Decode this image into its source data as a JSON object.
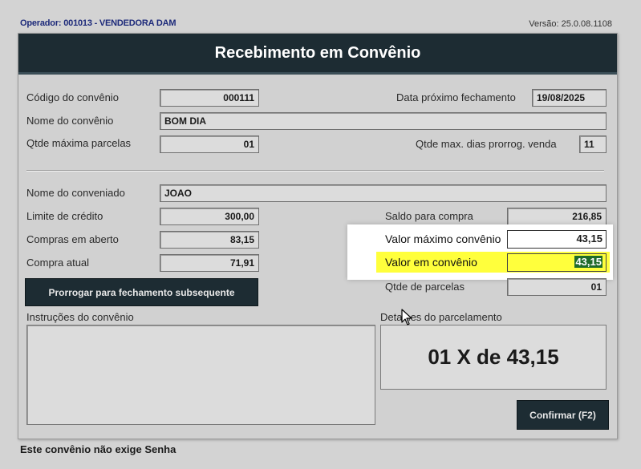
{
  "header": {
    "operator": "Operador: 001013 - VENDEDORA DAM",
    "version": "Versão: 25.0.08.1108"
  },
  "window": {
    "title": "Recebimento em Convênio"
  },
  "convenio": {
    "codigo_label": "Código do convênio",
    "codigo_value": "000111",
    "data_fechamento_label": "Data próximo fechamento",
    "data_fechamento_value": "19/08/2025",
    "nome_label": "Nome do convênio",
    "nome_value": "BOM DIA",
    "qtde_parcelas_label": "Qtde máxima parcelas",
    "qtde_parcelas_value": "01",
    "qtde_dias_label": "Qtde max. dias prorrog. venda",
    "qtde_dias_value": "11"
  },
  "conveniado": {
    "nome_label": "Nome do conveniado",
    "nome_value": "JOAO",
    "limite_label": "Limite de crédito",
    "limite_value": "300,00",
    "compras_aberto_label": "Compras em aberto",
    "compras_aberto_value": "83,15",
    "compra_atual_label": "Compra atual",
    "compra_atual_value": "71,91",
    "saldo_label": "Saldo para compra",
    "saldo_value": "216,85",
    "valor_maximo_label": "Valor máximo convênio",
    "valor_maximo_value": "43,15",
    "valor_convenio_label": "Valor em convênio",
    "valor_convenio_value": "43,15",
    "qtde_parcelas_label": "Qtde de parcelas",
    "qtde_parcelas_value": "01"
  },
  "actions": {
    "prorrogar_label": "Prorrogar para fechamento subsequente",
    "confirmar_label": "Confirmar (F2)"
  },
  "instrucoes": {
    "label": "Instruções do convênio",
    "value": ""
  },
  "detalhes": {
    "label": "Detalhes do parcelamento",
    "value": "01 X de 43,15"
  },
  "footer": {
    "senha_text": "Este convênio não exige Senha"
  },
  "colors": {
    "titlebar": "#1d2c33",
    "highlight": "#ffff3c",
    "selection": "#1f6b2a"
  }
}
